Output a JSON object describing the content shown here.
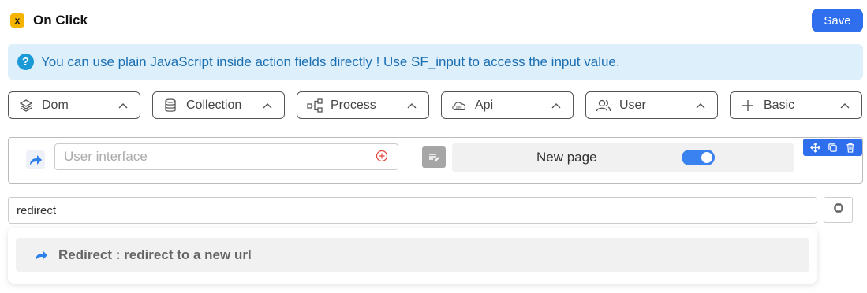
{
  "header": {
    "logo_glyph": "x",
    "title": "On Click",
    "save_label": "Save"
  },
  "info": {
    "icon_glyph": "?",
    "text": "You can use plain JavaScript inside action fields directly ! Use SF_input to access the input value."
  },
  "categories": [
    {
      "label": "Dom",
      "icon": "layers-icon"
    },
    {
      "label": "Collection",
      "icon": "database-icon"
    },
    {
      "label": "Process",
      "icon": "workflow-icon"
    },
    {
      "label": "Api",
      "icon": "cloud-api-icon"
    },
    {
      "label": "User",
      "icon": "users-icon"
    },
    {
      "label": "Basic",
      "icon": "plus-icon"
    }
  ],
  "action": {
    "input_placeholder": "User interface",
    "input_value": "",
    "new_page_label": "New page",
    "new_page_enabled": true
  },
  "search": {
    "value": "redirect"
  },
  "dropdown": {
    "items": [
      {
        "label": "Redirect : redirect to a new url"
      }
    ]
  },
  "colors": {
    "accent": "#2f6fed",
    "info_bg": "#ddeffb",
    "info_text": "#1b6fb3"
  }
}
